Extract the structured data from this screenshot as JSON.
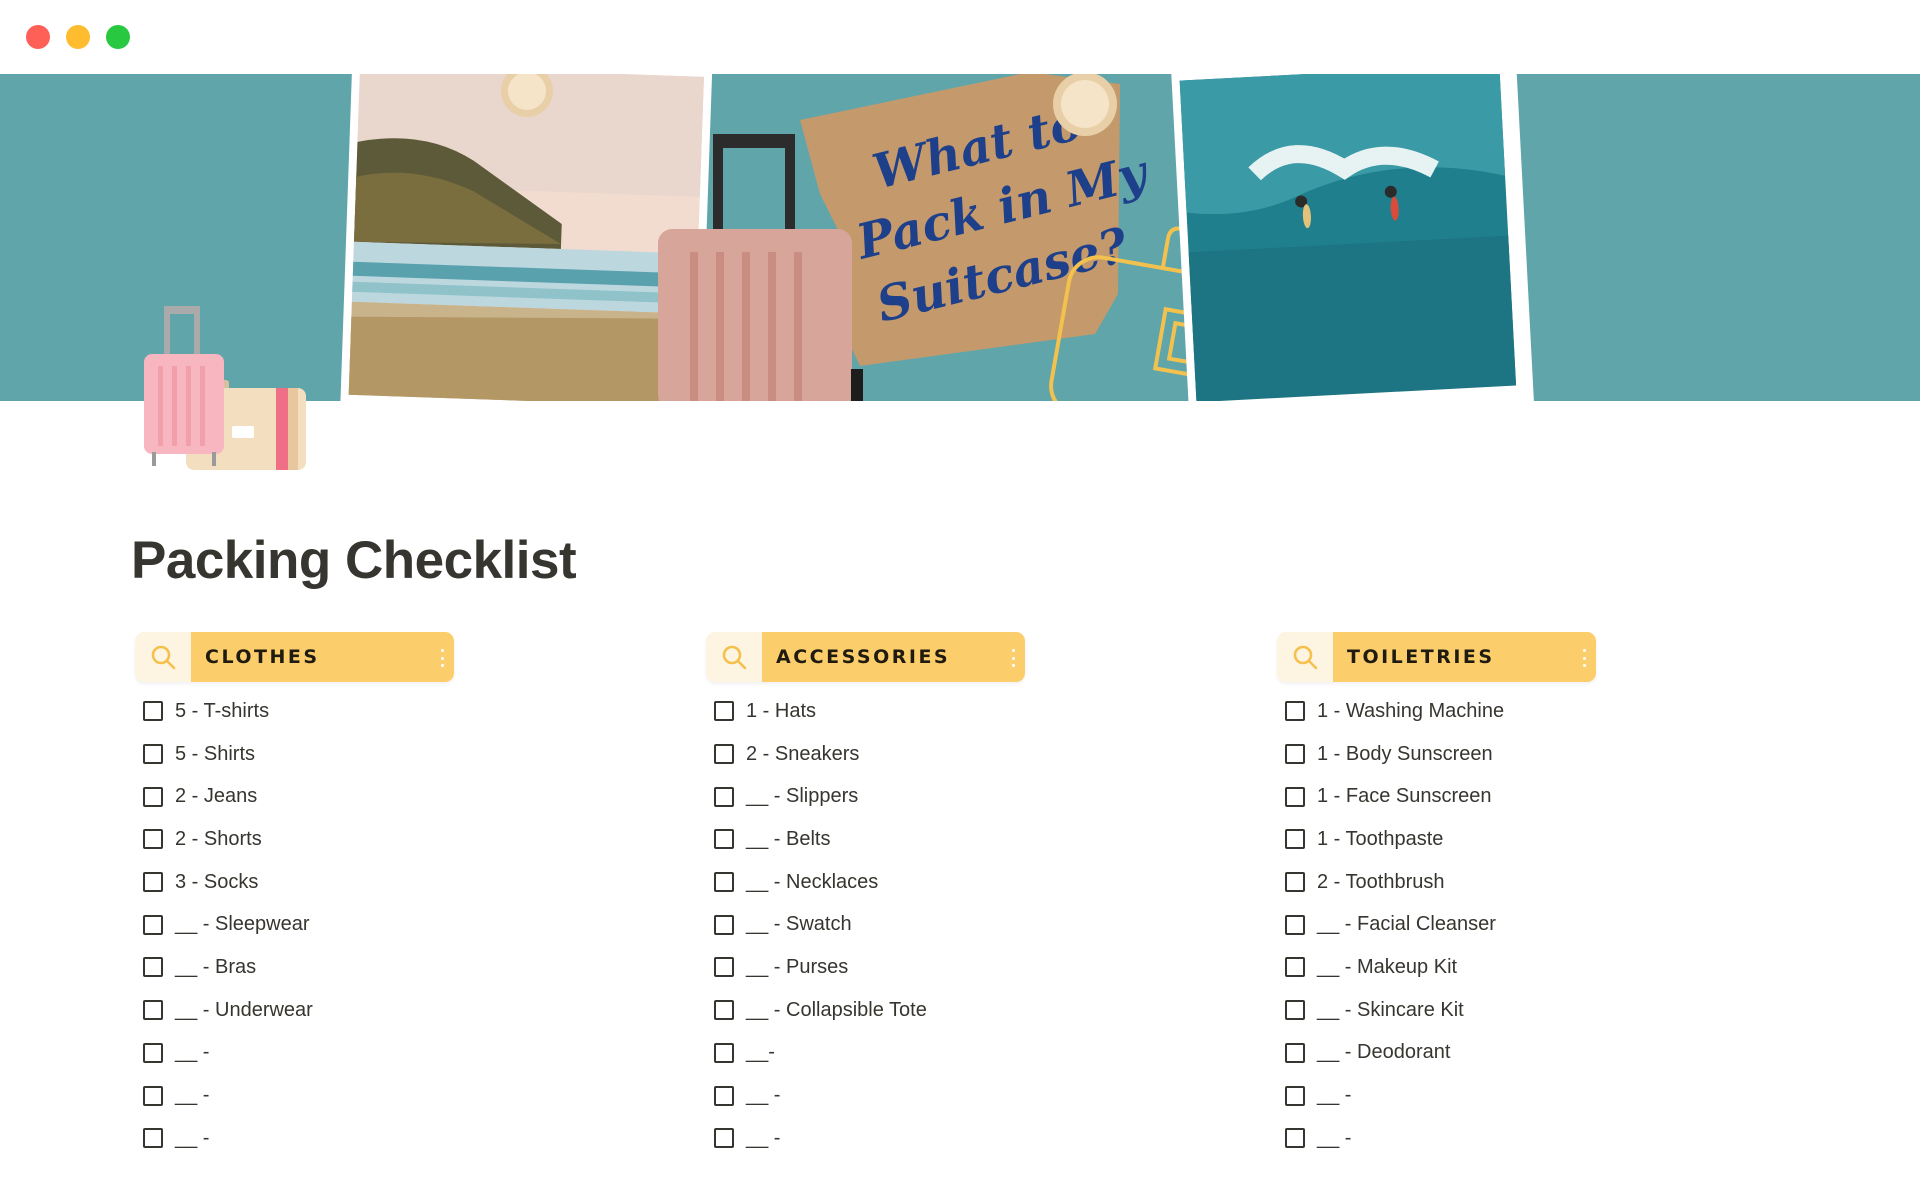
{
  "window": {
    "controls": [
      "close",
      "minimize",
      "zoom"
    ],
    "colors": {
      "close": "#fe5f57",
      "minimize": "#febc2e",
      "zoom": "#28c840"
    }
  },
  "cover": {
    "background": "#5fa5aa",
    "note_text": [
      "What to",
      "Pack in My",
      "Suitcase?"
    ],
    "note_color": "#c49a6c",
    "images": [
      "beach-photo",
      "suitcase-illustration",
      "kraft-paper-note",
      "suitcase-outline-drawing",
      "surfers-photo"
    ]
  },
  "page": {
    "icon": "luggage-icon",
    "title": "Packing Checklist"
  },
  "theme": {
    "header_accent": "#fccd6b",
    "search_bg": "#fdf5e2"
  },
  "categories": [
    {
      "name": "CLOTHES",
      "items": [
        "5 - T-shirts",
        "5 - Shirts",
        "2 - Jeans",
        "2 - Shorts",
        "3 - Socks",
        "__ - Sleepwear",
        "__ - Bras",
        "__ - Underwear",
        "__ -",
        "__ -",
        "__ -"
      ]
    },
    {
      "name": "ACCESSORIES",
      "items": [
        "1 - Hats",
        "2 - Sneakers",
        "__ - Slippers",
        "__ - Belts",
        "__ - Necklaces",
        "__ - Swatch",
        "__ - Purses",
        "__ - Collapsible Tote",
        "__-",
        "__ -",
        "__ -"
      ]
    },
    {
      "name": "TOILETRIES",
      "items": [
        "1 - Washing Machine",
        "1 - Body Sunscreen",
        "1 - Face Sunscreen",
        "1 - Toothpaste",
        "2 - Toothbrush",
        "__ - Facial Cleanser",
        "__ - Makeup Kit",
        "__ - Skincare Kit",
        "__ - Deodorant",
        "__ -",
        "__ -"
      ]
    }
  ]
}
